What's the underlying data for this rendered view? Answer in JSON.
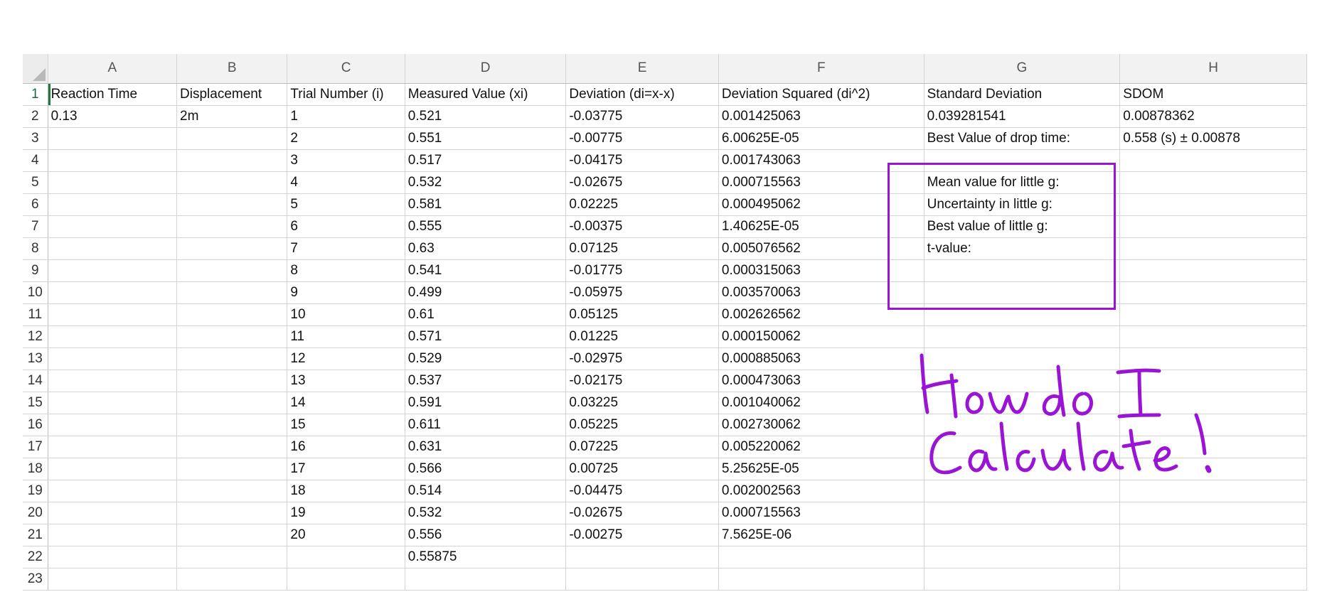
{
  "columns": [
    "A",
    "B",
    "C",
    "D",
    "E",
    "F",
    "G",
    "H"
  ],
  "rows": [
    {
      "n": "1",
      "cells": [
        "Reaction Time",
        "Displacement",
        "Trial Number (i)",
        "Measured Value (xi)",
        "Deviation (di=x-x)",
        "Deviation Squared (di^2)",
        "Standard Deviation",
        "SDOM"
      ]
    },
    {
      "n": "2",
      "cells": [
        "0.13",
        "2m",
        "1",
        "0.521",
        "-0.03775",
        "0.001425063",
        "0.039281541",
        "0.00878362"
      ]
    },
    {
      "n": "3",
      "cells": [
        "",
        "",
        "2",
        "0.551",
        "-0.00775",
        "6.00625E-05",
        "Best Value of drop time:",
        "0.558 (s) ± 0.00878"
      ]
    },
    {
      "n": "4",
      "cells": [
        "",
        "",
        "3",
        "0.517",
        "-0.04175",
        "0.001743063",
        "",
        ""
      ]
    },
    {
      "n": "5",
      "cells": [
        "",
        "",
        "4",
        "0.532",
        "-0.02675",
        "0.000715563",
        "Mean value for little g:",
        ""
      ]
    },
    {
      "n": "6",
      "cells": [
        "",
        "",
        "5",
        "0.581",
        "0.02225",
        "0.000495062",
        "Uncertainty in little g:",
        ""
      ]
    },
    {
      "n": "7",
      "cells": [
        "",
        "",
        "6",
        "0.555",
        "-0.00375",
        "1.40625E-05",
        "Best value of little g:",
        ""
      ]
    },
    {
      "n": "8",
      "cells": [
        "",
        "",
        "7",
        "0.63",
        "0.07125",
        "0.005076562",
        "t-value:",
        ""
      ]
    },
    {
      "n": "9",
      "cells": [
        "",
        "",
        "8",
        "0.541",
        "-0.01775",
        "0.000315063",
        "",
        ""
      ]
    },
    {
      "n": "10",
      "cells": [
        "",
        "",
        "9",
        "0.499",
        "-0.05975",
        "0.003570063",
        "",
        ""
      ]
    },
    {
      "n": "11",
      "cells": [
        "",
        "",
        "10",
        "0.61",
        "0.05125",
        "0.002626562",
        "",
        ""
      ]
    },
    {
      "n": "12",
      "cells": [
        "",
        "",
        "11",
        "0.571",
        "0.01225",
        "0.000150062",
        "",
        ""
      ]
    },
    {
      "n": "13",
      "cells": [
        "",
        "",
        "12",
        "0.529",
        "-0.02975",
        "0.000885063",
        "",
        ""
      ]
    },
    {
      "n": "14",
      "cells": [
        "",
        "",
        "13",
        "0.537",
        "-0.02175",
        "0.000473063",
        "",
        ""
      ]
    },
    {
      "n": "15",
      "cells": [
        "",
        "",
        "14",
        "0.591",
        "0.03225",
        "0.001040062",
        "",
        ""
      ]
    },
    {
      "n": "16",
      "cells": [
        "",
        "",
        "15",
        "0.611",
        "0.05225",
        "0.002730062",
        "",
        ""
      ]
    },
    {
      "n": "17",
      "cells": [
        "",
        "",
        "16",
        "0.631",
        "0.07225",
        "0.005220062",
        "",
        ""
      ]
    },
    {
      "n": "18",
      "cells": [
        "",
        "",
        "17",
        "0.566",
        "0.00725",
        "5.25625E-05",
        "",
        ""
      ]
    },
    {
      "n": "19",
      "cells": [
        "",
        "",
        "18",
        "0.514",
        "-0.04475",
        "0.002002563",
        "",
        ""
      ]
    },
    {
      "n": "20",
      "cells": [
        "",
        "",
        "19",
        "0.532",
        "-0.02675",
        "0.000715563",
        "",
        ""
      ]
    },
    {
      "n": "21",
      "cells": [
        "",
        "",
        "20",
        "0.556",
        "-0.00275",
        "7.5625E-06",
        "",
        ""
      ]
    },
    {
      "n": "22",
      "cells": [
        "",
        "",
        "",
        "0.55875",
        "",
        "",
        "",
        ""
      ]
    },
    {
      "n": "23",
      "cells": [
        "",
        "",
        "",
        "",
        "",
        "",
        "",
        ""
      ]
    }
  ],
  "annotation": {
    "handwritten_text": "How do I Calculate?",
    "ink_color": "#9a14d6"
  },
  "colors": {
    "active_row_header": "#1d6b3a",
    "grid_line": "#d4d4d4",
    "header_bg": "#f2f2f2"
  }
}
